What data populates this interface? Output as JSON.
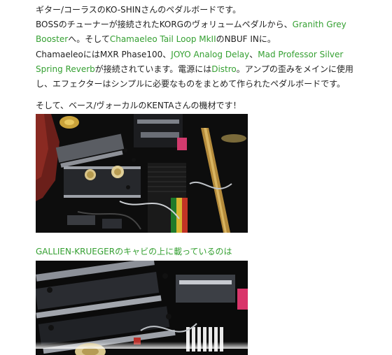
{
  "article": {
    "p1": "ギター/コーラスのKO-SHINさんのペダルボードです。",
    "p2": {
      "t1": "BOSSのチューナーが接続されたKORGのヴォリュームペダルから、",
      "link1": "Granith Grey Booster",
      "t2": "へ。そして",
      "link2": "Chamaeleo Tail Loop MkII",
      "t3": "のNBUF INに。"
    },
    "p3": {
      "t1": "ChamaeleoにはMXR Phase100、",
      "link1": "JOYO Analog Delay",
      "t2": "、",
      "link2": "Mad Professor Silver Spring Reverb",
      "t3": "が接続されています。電源には",
      "link3": "Distro",
      "t4": "。アンプの歪みをメインに使用し、エフェクターはシンプルに必要なものをまとめて作られたペダルボードです。"
    },
    "p4": "そして、ベース/ヴォーカルのKENTAさんの機材です！",
    "heading2": "GALLIEN-KRUEGERのキャビの上に載っているのは"
  },
  "colors": {
    "link": "#35a032",
    "text": "#222222"
  }
}
